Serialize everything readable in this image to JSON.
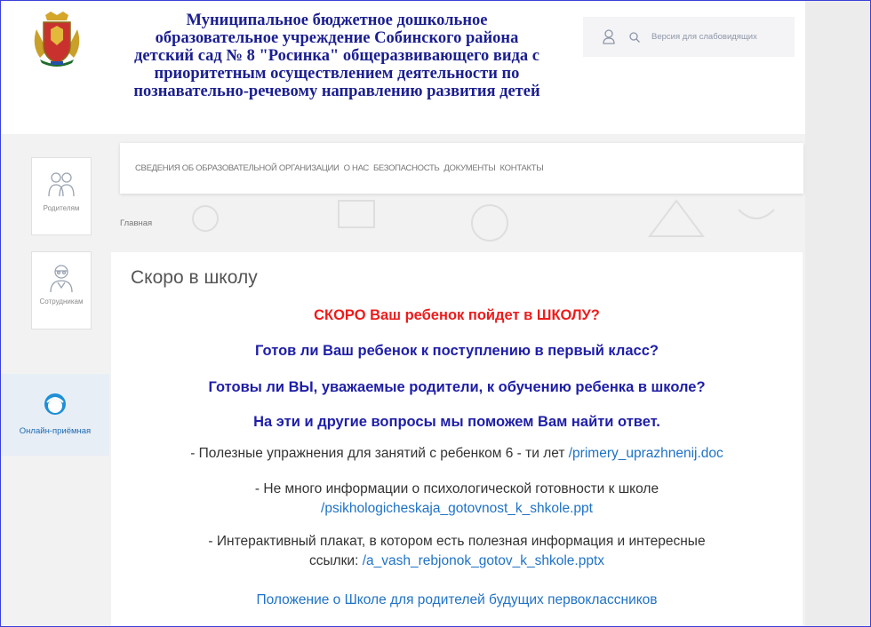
{
  "header": {
    "org_lines": [
      "Муниципальное бюджетное дошкольное",
      "образовательное учреждение Собинского района",
      "детский сад № 8 \"Росинка\" общеразвивающего вида с",
      "приоритетным осуществлением деятельности по",
      "познавательно-речевому направлению развития детей"
    ],
    "vision_label": "Версия для слабовидящих",
    "user_icon": "user-icon",
    "search_icon": "search-icon"
  },
  "sidebar": {
    "items": [
      {
        "label": "Родителям",
        "icon": "parents-icon"
      },
      {
        "label": "Сотрудникам",
        "icon": "staff-icon"
      },
      {
        "label": "Онлайн-приёмная",
        "icon": "online-reception-icon"
      }
    ]
  },
  "nav": {
    "items": [
      "СВЕДЕНИЯ ОБ ОБРАЗОВАТЕЛЬНОЙ ОРГАНИЗАЦИИ",
      "О НАС",
      "БЕЗОПАСНОСТЬ",
      "ДОКУМЕНТЫ",
      "КОНТАКТЫ"
    ]
  },
  "breadcrumb": "Главная",
  "page": {
    "title": "Скоро в школу",
    "headline_red": "СКОРО Ваш ребенок пойдет в ШКОЛУ?",
    "headline_q1": "Готов ли Ваш ребенок к поступлению в первый класс?",
    "headline_q2": "Готовы ли ВЫ, уважаемые родители, к обучению ребенка в школе?",
    "headline_q3": "На эти и другие вопросы мы поможем Вам найти ответ.",
    "item1_text": "- Полезные упражнения для занятий с ребенком 6 - ти лет ",
    "item1_link": "/primery_uprazhnenij.doc",
    "item2_text": "- Не много информации о психологической готовности к школе",
    "item2_link": "/psikhologicheskaja_gotovnost_k_shkole.ppt",
    "item3_text_line1": "- Интерактивный плакат, в котором есть полезная информация и интересные",
    "item3_text_line2": "ссылки: ",
    "item3_link": "/a_vash_rebjonok_gotov_k_shkole.pptx",
    "regulation_link": "Положение о Школе для родителей будущих первоклассников"
  },
  "colors": {
    "org_title": "#1b1f8f",
    "headline_red": "#ee1b1b",
    "headline_blue": "#1e1ea8",
    "link": "#1f72c6",
    "frame_border": "#3b3fd8"
  }
}
